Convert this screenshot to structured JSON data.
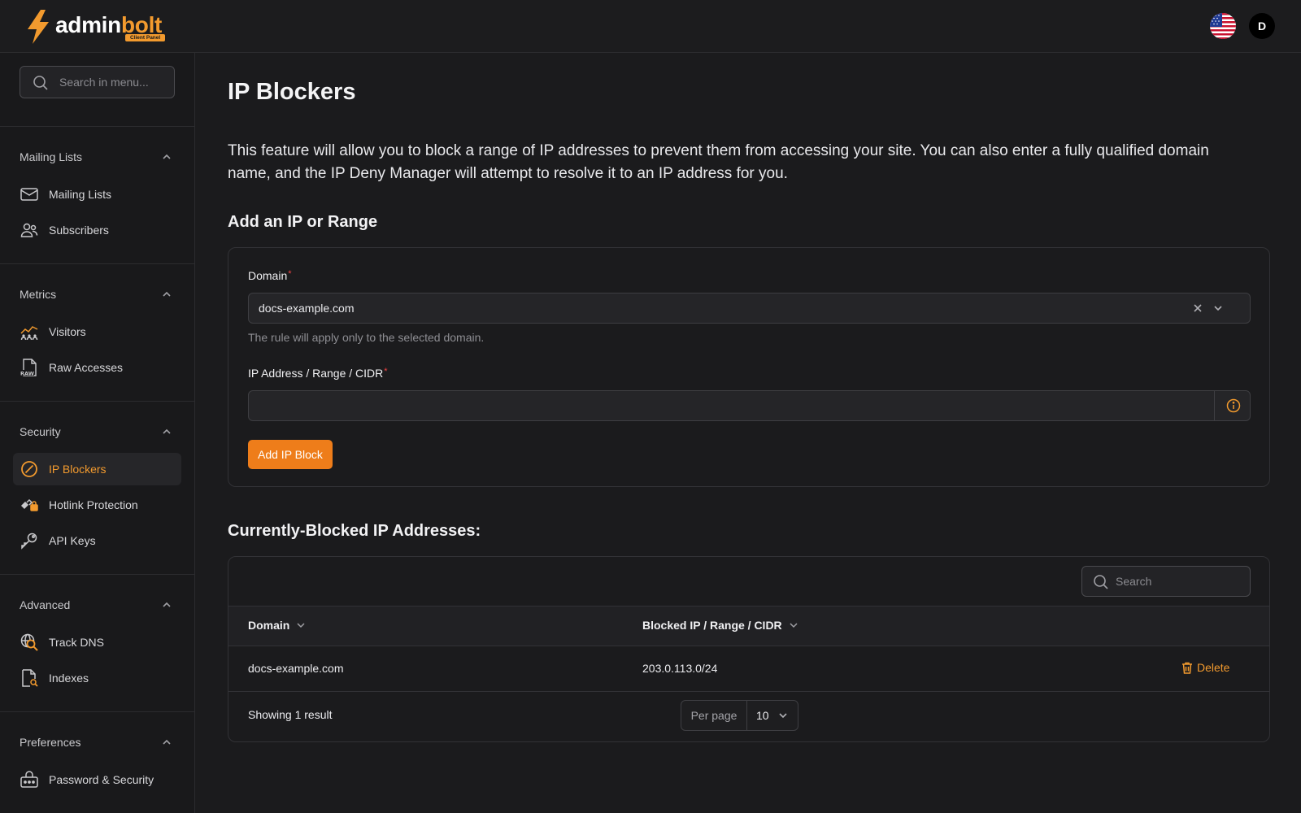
{
  "brand": {
    "name_part1": "admin",
    "name_part2": "bolt",
    "badge": "Client Panel",
    "accent_color": "#f29a2e"
  },
  "header": {
    "language_flag": "us-flag-icon",
    "avatar_initial": "D"
  },
  "sidebar": {
    "search_placeholder": "Search in menu...",
    "groups": [
      {
        "title": "Mailing Lists",
        "items": [
          {
            "label": "Mailing Lists",
            "icon": "envelope-icon"
          },
          {
            "label": "Subscribers",
            "icon": "users-icon"
          }
        ]
      },
      {
        "title": "Metrics",
        "items": [
          {
            "label": "Visitors",
            "icon": "visitors-chart-icon"
          },
          {
            "label": "Raw Accesses",
            "icon": "raw-file-icon"
          }
        ]
      },
      {
        "title": "Security",
        "items": [
          {
            "label": "IP Blockers",
            "icon": "ban-icon",
            "active": true
          },
          {
            "label": "Hotlink Protection",
            "icon": "chain-lock-icon"
          },
          {
            "label": "API Keys",
            "icon": "key-icon"
          }
        ]
      },
      {
        "title": "Advanced",
        "items": [
          {
            "label": "Track DNS",
            "icon": "dns-search-icon"
          },
          {
            "label": "Indexes",
            "icon": "file-search-icon"
          }
        ]
      },
      {
        "title": "Preferences",
        "items": [
          {
            "label": "Password & Security",
            "icon": "password-lock-icon"
          }
        ]
      }
    ]
  },
  "page": {
    "title": "IP Blockers",
    "intro": "This feature will allow you to block a range of IP addresses to prevent them from accessing your site. You can also enter a fully qualified domain name, and the IP Deny Manager will attempt to resolve it to an IP address for you.",
    "add_section_title": "Add an IP or Range",
    "form": {
      "domain_label": "Domain",
      "domain_value": "docs-example.com",
      "domain_hint": "The rule will apply only to the selected domain.",
      "ip_label": "IP Address / Range / CIDR",
      "ip_value": "",
      "required_mark": "*",
      "submit_label": "Add IP Block"
    },
    "list_section_title": "Currently-Blocked IP Addresses:",
    "table": {
      "search_placeholder": "Search",
      "columns": [
        "Domain",
        "Blocked IP / Range / CIDR"
      ],
      "rows": [
        {
          "domain": "docs-example.com",
          "ip": "203.0.113.0/24",
          "action": "Delete"
        }
      ],
      "showing_text": "Showing 1 result",
      "per_page_label": "Per page",
      "per_page_value": "10"
    }
  }
}
